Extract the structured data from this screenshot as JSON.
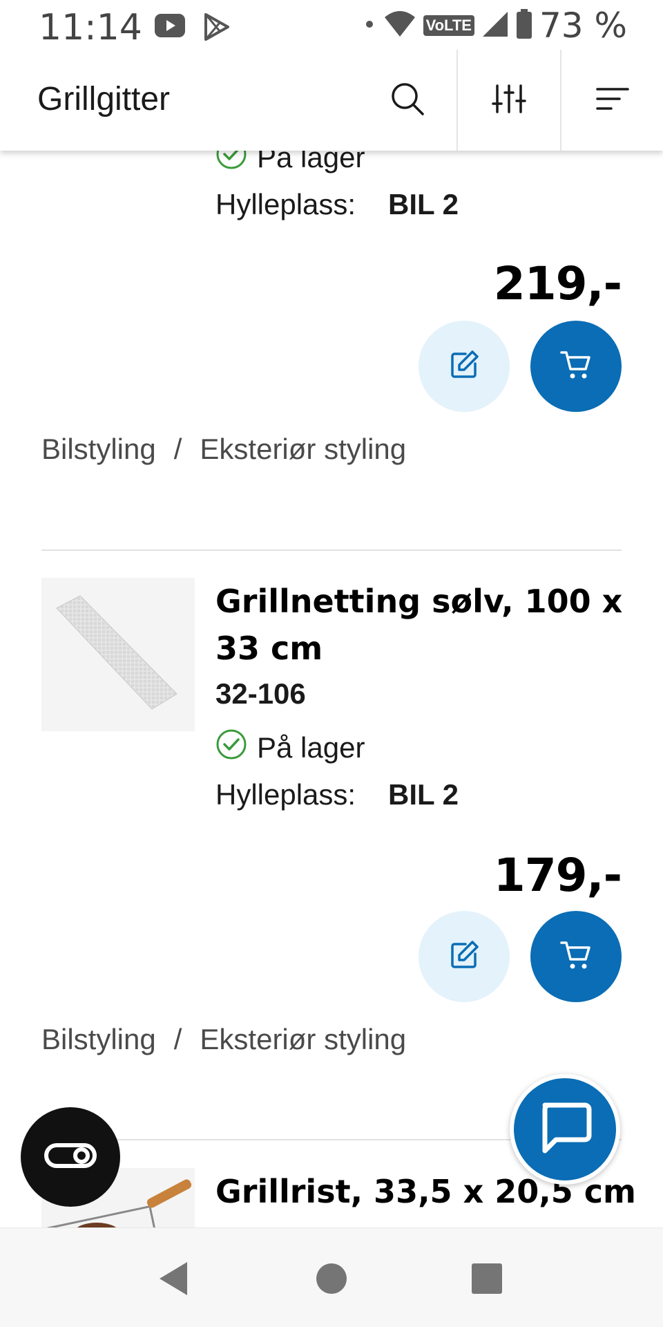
{
  "status_bar": {
    "time": "11:14",
    "battery_text": "73 %",
    "network_badge": "VoLTE"
  },
  "app_bar": {
    "title": "Grillgitter"
  },
  "colors": {
    "primary": "#0a6db5",
    "edit_bg": "#e3f2fb",
    "stock_green": "#3a9b3a"
  },
  "products": [
    {
      "stock": "På lager",
      "shelf_label": "Hylleplass:",
      "shelf_value": "BIL 2",
      "price": "219,-",
      "breadcrumb": [
        "Bilstyling",
        "/",
        "Eksteriør styling"
      ]
    },
    {
      "title": "Grillnetting sølv, 100 x 33 cm",
      "sku": "32-106",
      "stock": "På lager",
      "shelf_label": "Hylleplass:",
      "shelf_value": "BIL 2",
      "price": "179,-",
      "breadcrumb": [
        "Bilstyling",
        "/",
        "Eksteriør styling"
      ]
    },
    {
      "title": "Grillrist, 33,5 x 20,5 cm"
    }
  ]
}
